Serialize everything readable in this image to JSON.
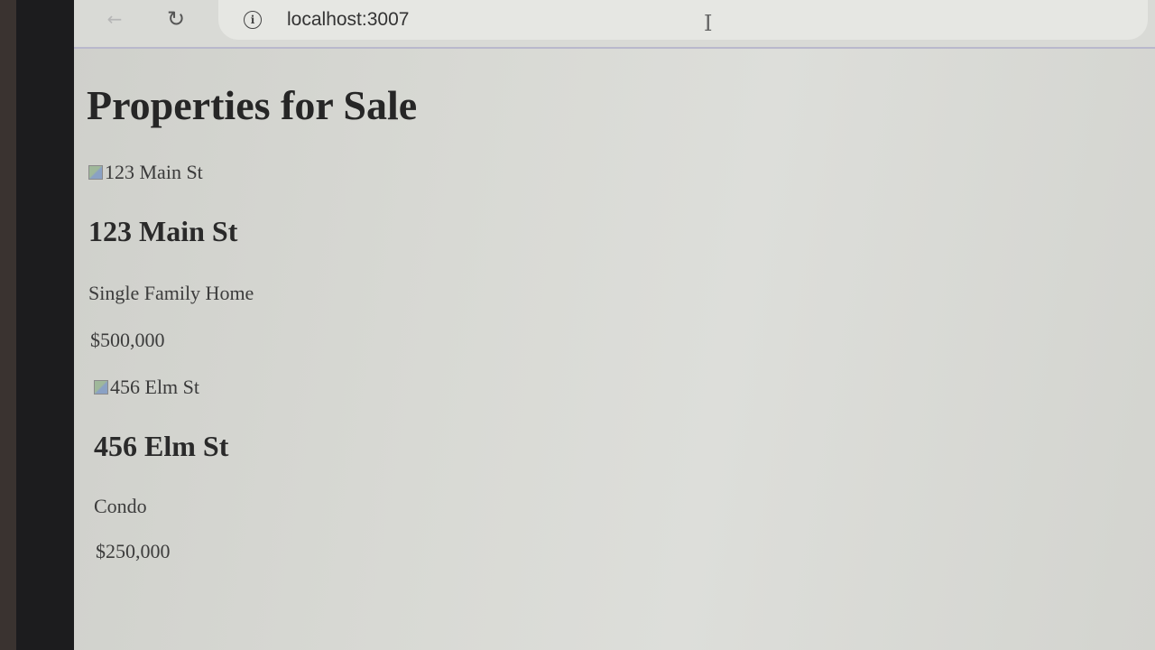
{
  "browser": {
    "url": "localhost:3007",
    "back_icon": "arrow-left-icon",
    "reload_icon": "reload-icon",
    "site_info_icon": "info-icon",
    "reload_glyph": "↻",
    "back_glyph": "←",
    "info_glyph": "i",
    "text_cursor_glyph": "I"
  },
  "page": {
    "title": "Properties for Sale",
    "properties": [
      {
        "image_alt": "123 Main St",
        "address": "123 Main St",
        "type": "Single Family Home",
        "price": "$500,000"
      },
      {
        "image_alt": "456 Elm St",
        "address": "456 Elm St",
        "type": "Condo",
        "price": "$250,000"
      }
    ]
  },
  "colors": {
    "page_background": "#d9dad5",
    "text": "#2a2a2a",
    "toolbar": "#d9dad6",
    "bezel": "#1c1c1e"
  }
}
